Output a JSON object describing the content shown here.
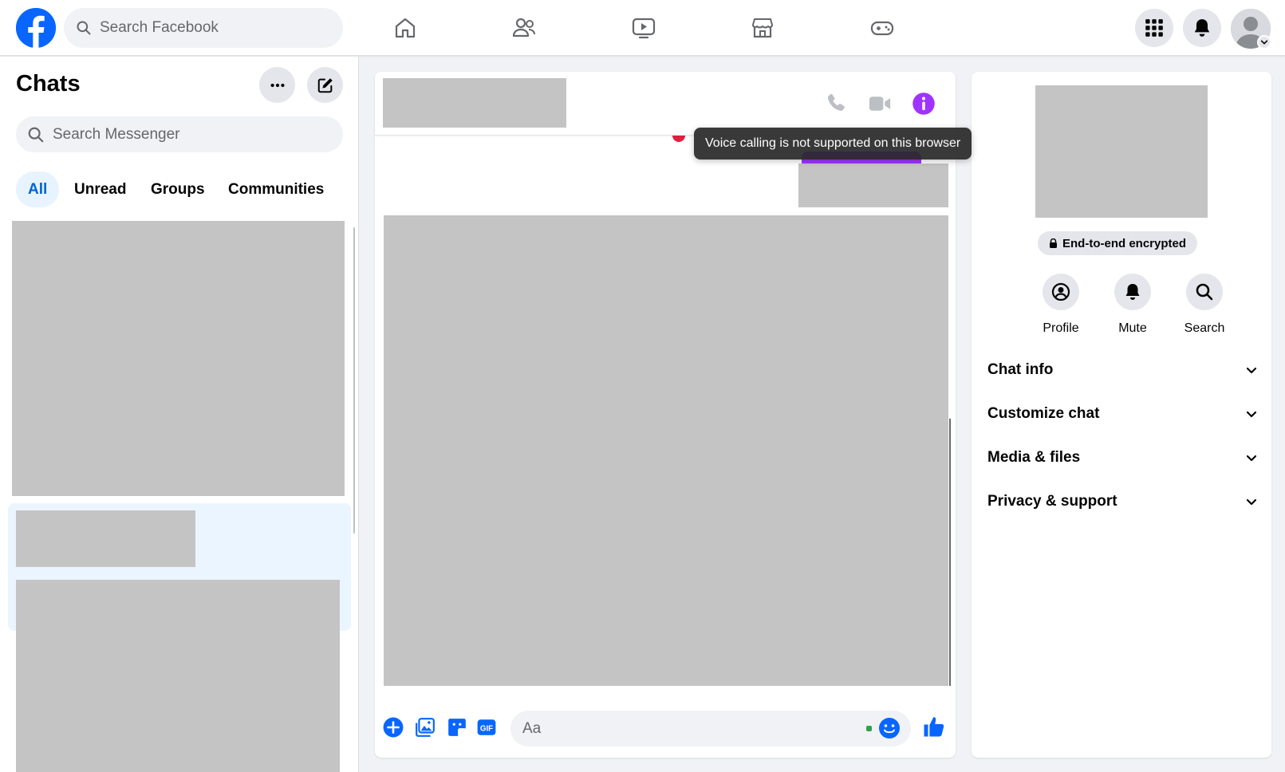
{
  "topbar": {
    "search_placeholder": "Search Facebook",
    "brand_color": "#0866ff"
  },
  "sidebar": {
    "title": "Chats",
    "search_placeholder": "Search Messenger",
    "tabs": [
      {
        "label": "All",
        "active": true
      },
      {
        "label": "Unread",
        "active": false
      },
      {
        "label": "Groups",
        "active": false
      },
      {
        "label": "Communities",
        "active": false
      }
    ]
  },
  "chat": {
    "composer_placeholder": "Aa",
    "accent_color": "#a033ff"
  },
  "tooltip": {
    "text": "Voice calling is not supported on this browser"
  },
  "info": {
    "encryption_label": "End-to-end encrypted",
    "actions": [
      {
        "label": "Profile",
        "icon": "profile-icon"
      },
      {
        "label": "Mute",
        "icon": "bell-icon"
      },
      {
        "label": "Search",
        "icon": "search-icon"
      }
    ],
    "sections": [
      {
        "label": "Chat info"
      },
      {
        "label": "Customize chat"
      },
      {
        "label": "Media & files"
      },
      {
        "label": "Privacy & support"
      }
    ]
  }
}
